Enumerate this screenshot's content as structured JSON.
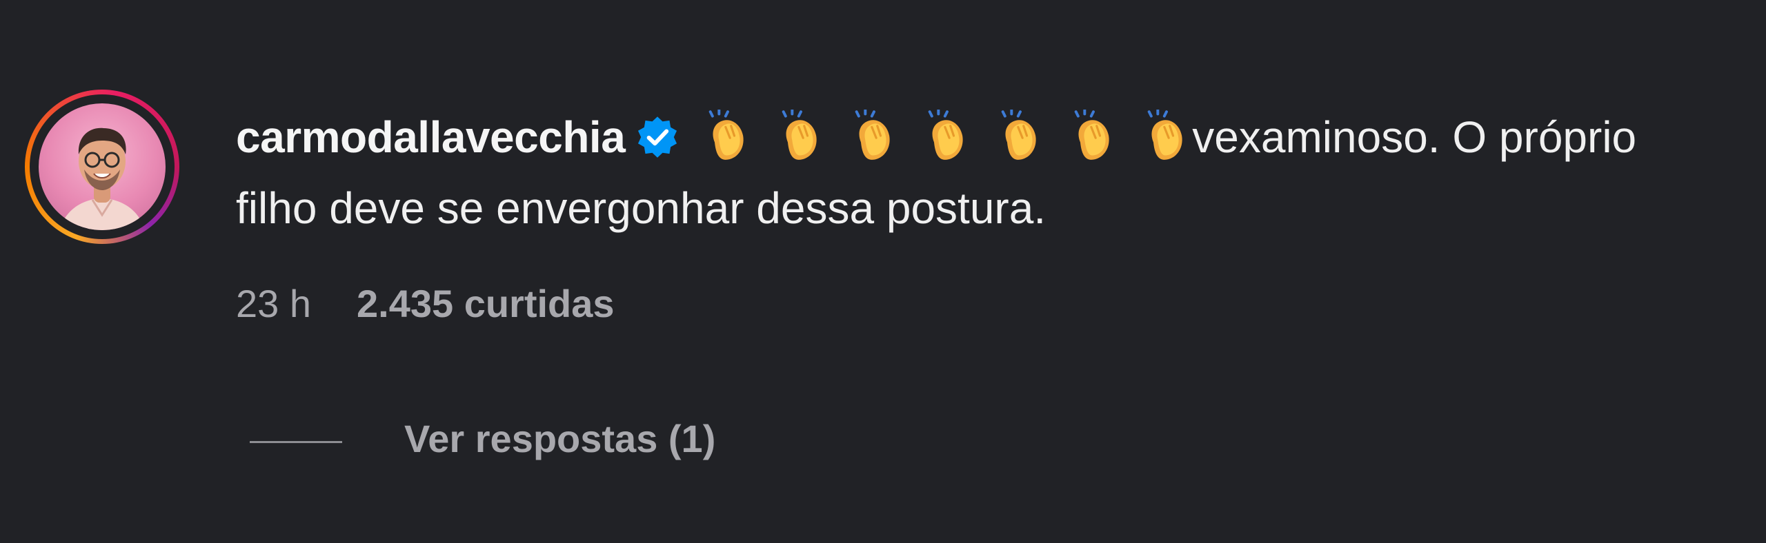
{
  "comment": {
    "username": "carmodallavecchia",
    "verified": true,
    "icons": {
      "verified": "verified-badge-icon",
      "clap": "clapping-hands-icon"
    },
    "clap_count": 7,
    "text_line": "vexaminoso. O próprio filho deve se envergonhar dessa postura.",
    "time": "23 h",
    "likes": "2.435 curtidas",
    "view_replies": "Ver respostas (1)"
  },
  "colors": {
    "background": "#212226",
    "text_primary": "#f5f5f5",
    "text_secondary": "#a8a8ad",
    "verified_blue": "#0095f6"
  }
}
